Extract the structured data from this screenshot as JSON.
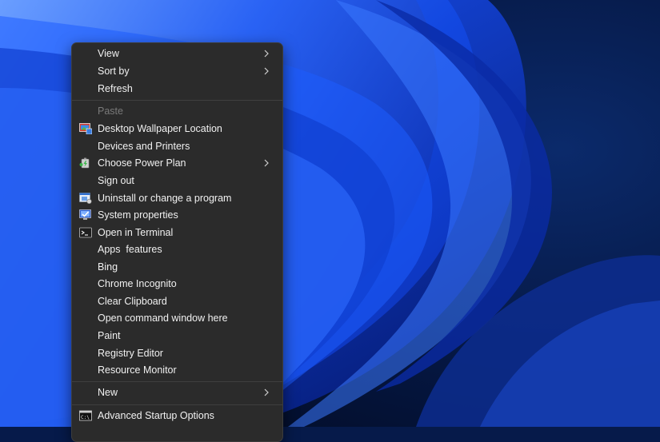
{
  "menu": {
    "items": [
      {
        "label": "View",
        "submenu": true
      },
      {
        "label": "Sort by",
        "submenu": true
      },
      {
        "label": "Refresh"
      },
      {
        "label": "Paste",
        "disabled": true
      },
      {
        "label": "Desktop Wallpaper Location",
        "icon": "wallpaper-location-icon"
      },
      {
        "label": "Devices and Printers"
      },
      {
        "label": "Choose Power Plan",
        "icon": "power-plan-icon",
        "submenu": true
      },
      {
        "label": "Sign out"
      },
      {
        "label": "Uninstall or change a program",
        "icon": "programs-icon"
      },
      {
        "label": "System properties",
        "icon": "system-properties-icon"
      },
      {
        "label": "Open in Terminal",
        "icon": "terminal-icon"
      },
      {
        "label": "Apps  features"
      },
      {
        "label": "Bing"
      },
      {
        "label": "Chrome Incognito"
      },
      {
        "label": "Clear Clipboard"
      },
      {
        "label": "Open command window here"
      },
      {
        "label": "Paint"
      },
      {
        "label": "Registry Editor"
      },
      {
        "label": "Resource Monitor"
      },
      {
        "label": "New",
        "submenu": true
      },
      {
        "label": "Advanced Startup Options",
        "icon": "command-prompt-icon"
      }
    ]
  },
  "colors": {
    "menu_background": "#2b2b2b",
    "menu_text": "#f1f1f1",
    "disabled_text": "#7a7a7a",
    "separator": "#3f3f3f",
    "wallpaper_blue": "#1b4fe0",
    "wallpaper_dark": "#061a4a"
  }
}
